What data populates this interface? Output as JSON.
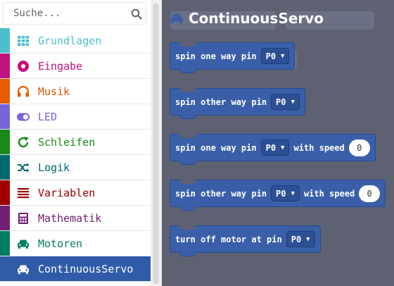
{
  "search": {
    "placeholder": "Suche..."
  },
  "categories": [
    {
      "label": "Grundlagen",
      "icon": "grid-icon",
      "color": "#4cbfce",
      "text_color": "#4cbfce",
      "selected": false
    },
    {
      "label": "Eingabe",
      "icon": "circle-dot-icon",
      "color": "#c0127e",
      "text_color": "#c0127e",
      "selected": false
    },
    {
      "label": "Musik",
      "icon": "headphones-icon",
      "color": "#e65c00",
      "text_color": "#d9560b",
      "selected": false
    },
    {
      "label": "LED",
      "icon": "toggle-icon",
      "color": "#7a63d9",
      "text_color": "#7a63d9",
      "selected": false
    },
    {
      "label": "Schleifen",
      "icon": "refresh-icon",
      "color": "#188a18",
      "text_color": "#188a18",
      "selected": false
    },
    {
      "label": "Logik",
      "icon": "shuffle-icon",
      "color": "#006970",
      "text_color": "#006970",
      "selected": false
    },
    {
      "label": "Variablen",
      "icon": "list-icon",
      "color": "#a00000",
      "text_color": "#a00000",
      "selected": false
    },
    {
      "label": "Mathematik",
      "icon": "calculator-icon",
      "color": "#702070",
      "text_color": "#702070",
      "selected": false
    },
    {
      "label": "Motoren",
      "icon": "car-icon",
      "color": "#007e62",
      "text_color": "#007e62",
      "selected": false
    },
    {
      "label": "ContinuousServo",
      "icon": "car-icon",
      "color": "#2f5ba8",
      "text_color": "#ffffff",
      "selected": true
    }
  ],
  "flyout": {
    "title": "ContinuousServo",
    "title_icon": "car-icon",
    "blocks": [
      {
        "name": "spin-one-way-block",
        "text": "spin one way pin",
        "pin": "P0",
        "speed_label": "",
        "speed": ""
      },
      {
        "name": "spin-other-way-block",
        "text": "spin other way pin",
        "pin": "P0",
        "speed_label": "",
        "speed": ""
      },
      {
        "name": "spin-one-way-speed-block",
        "text": "spin one way pin",
        "pin": "P0",
        "speed_label": "with speed",
        "speed": "0"
      },
      {
        "name": "spin-other-way-speed-block",
        "text": "spin other way pin",
        "pin": "P0",
        "speed_label": "with speed",
        "speed": "0"
      },
      {
        "name": "turn-off-motor-block",
        "text": "turn off motor at pin",
        "pin": "P0",
        "speed_label": "",
        "speed": ""
      }
    ]
  },
  "colors": {
    "workspace_bg": "#5d6171",
    "block_fill": "#3a5fa8",
    "selected_row": "#2f5ba8"
  }
}
